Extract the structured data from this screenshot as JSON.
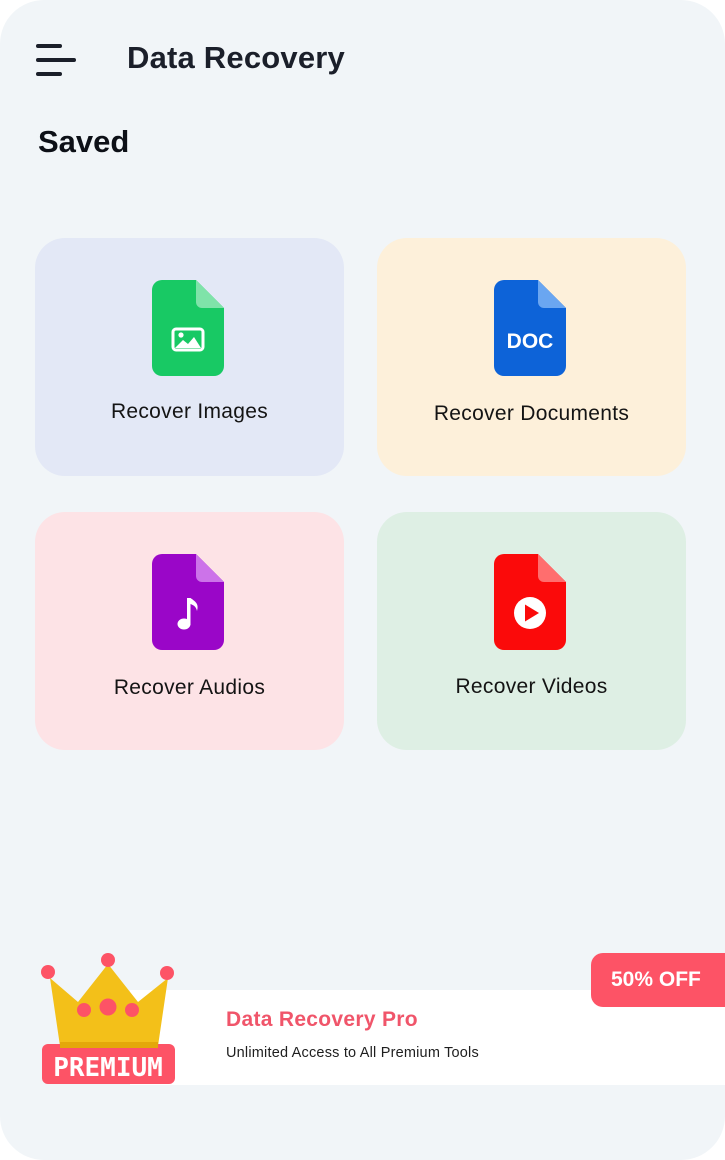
{
  "header": {
    "title": "Data Recovery",
    "menu_icon": "hamburger-menu-icon"
  },
  "section": {
    "title": "Saved"
  },
  "cards": [
    {
      "label": "Recover Images",
      "icon": "image-file-icon",
      "color": "#18c964",
      "bg": "#e3e8f6"
    },
    {
      "label": "Recover Documents",
      "icon": "doc-file-icon",
      "icon_text": "DOC",
      "color": "#0d63d8",
      "bg": "#fdf0da"
    },
    {
      "label": "Recover Audios",
      "icon": "audio-file-icon",
      "color": "#9a06c8",
      "bg": "#fde3e6"
    },
    {
      "label": "Recover Videos",
      "icon": "video-file-icon",
      "color": "#fb0a0a",
      "bg": "#deefe4"
    }
  ],
  "promo": {
    "title": "Data Recovery Pro",
    "subtitle": "Unlimited Access to All Premium Tools",
    "badge": "50% OFF",
    "crown_text": "PREMIUM",
    "accent": "#f0556a",
    "crown_color": "#f3c019"
  }
}
